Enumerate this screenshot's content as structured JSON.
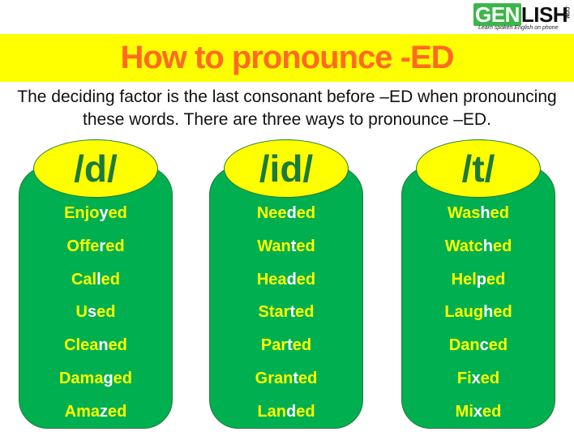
{
  "logo": {
    "left": "GEN",
    "right": "LISH",
    "suffix": ".COM",
    "tagline": "Learn spoken English on phone"
  },
  "title": "How to pronounce -ED",
  "subtitle": {
    "line1": "The deciding factor is the last consonant  before –ED when pronouncing",
    "line2": "these words. There are three ways to pronounce –ED."
  },
  "colors": {
    "title_bar": "#ffff00",
    "title_text": "#ff6a22",
    "box_fill": "#00b050",
    "sound_text": "#1b7a3c",
    "word_text": "#ffff00",
    "highlight_text": "#ffffff"
  },
  "columns": [
    {
      "sound": "/d/",
      "words": [
        {
          "pre": "Enjo",
          "hl": "y",
          "post": "ed"
        },
        {
          "pre": "Offe",
          "hl": "r",
          "post": "ed"
        },
        {
          "pre": "Cal",
          "hl": "l",
          "post": "ed"
        },
        {
          "pre": "U",
          "hl": "s",
          "post": "ed"
        },
        {
          "pre": "Clea",
          "hl": "n",
          "post": "ed"
        },
        {
          "pre": "Dama",
          "hl": "g",
          "post": "ed"
        },
        {
          "pre": "Ama",
          "hl": "z",
          "post": "ed"
        }
      ]
    },
    {
      "sound": "/id/",
      "words": [
        {
          "pre": "Nee",
          "hl": "d",
          "post": "ed"
        },
        {
          "pre": "Wan",
          "hl": "t",
          "post": "ed"
        },
        {
          "pre": "Hea",
          "hl": "d",
          "post": "ed"
        },
        {
          "pre": "Star",
          "hl": "t",
          "post": "ed"
        },
        {
          "pre": "Par",
          "hl": "t",
          "post": "ed"
        },
        {
          "pre": "Gran",
          "hl": "t",
          "post": "ed"
        },
        {
          "pre": "Lan",
          "hl": "d",
          "post": "ed"
        }
      ]
    },
    {
      "sound": "/t/",
      "words": [
        {
          "pre": "Was",
          "hl": "h",
          "post": "ed"
        },
        {
          "pre": "Watc",
          "hl": "h",
          "post": "ed"
        },
        {
          "pre": "Hel",
          "hl": "p",
          "post": "ed"
        },
        {
          "pre": "Laug",
          "hl": "h",
          "post": "ed"
        },
        {
          "pre": "Dan",
          "hl": "c",
          "post": "ed"
        },
        {
          "pre": "Fi",
          "hl": "x",
          "post": "ed"
        },
        {
          "pre": "Mi",
          "hl": "x",
          "post": "ed"
        }
      ]
    }
  ]
}
